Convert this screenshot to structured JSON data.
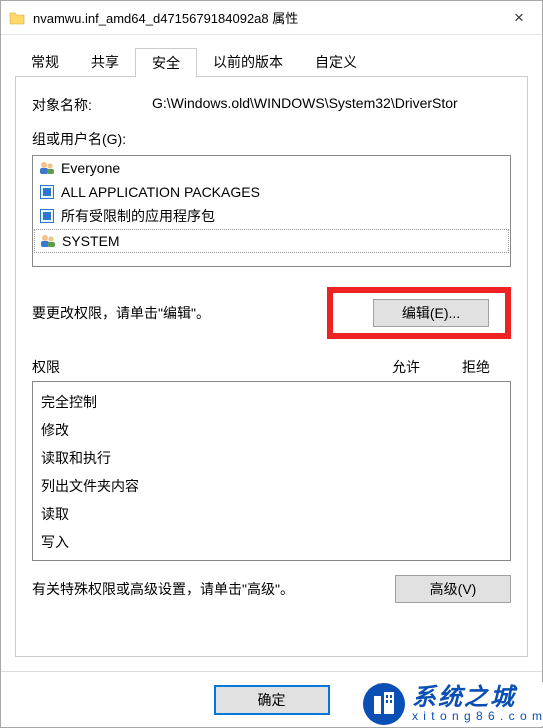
{
  "titlebar": {
    "title": "nvamwu.inf_amd64_d4715679184092a8 属性",
    "close_label": "×"
  },
  "tabs": {
    "general": "常规",
    "sharing": "共享",
    "security": "安全",
    "previous": "以前的版本",
    "custom": "自定义"
  },
  "object": {
    "label": "对象名称:",
    "value": "G:\\Windows.old\\WINDOWS\\System32\\DriverStor"
  },
  "groups": {
    "label": "组或用户名(G):",
    "items": [
      {
        "name": "Everyone",
        "icon": "users"
      },
      {
        "name": "ALL APPLICATION PACKAGES",
        "icon": "pkg"
      },
      {
        "name": "所有受限制的应用程序包",
        "icon": "pkg"
      },
      {
        "name": "SYSTEM",
        "icon": "users"
      }
    ]
  },
  "edit": {
    "hint": "要更改权限，请单击\"编辑\"。",
    "button": "编辑(E)..."
  },
  "perm": {
    "header_name": "权限",
    "header_allow": "允许",
    "header_deny": "拒绝",
    "items": [
      "完全控制",
      "修改",
      "读取和执行",
      "列出文件夹内容",
      "读取",
      "写入"
    ]
  },
  "advanced": {
    "hint": "有关特殊权限或高级设置，请单击\"高级\"。",
    "button": "高级(V)"
  },
  "footer": {
    "ok": "确定"
  },
  "watermark": {
    "zh": "系统之城",
    "en": "x i t o n g 8 6 . c o m"
  }
}
